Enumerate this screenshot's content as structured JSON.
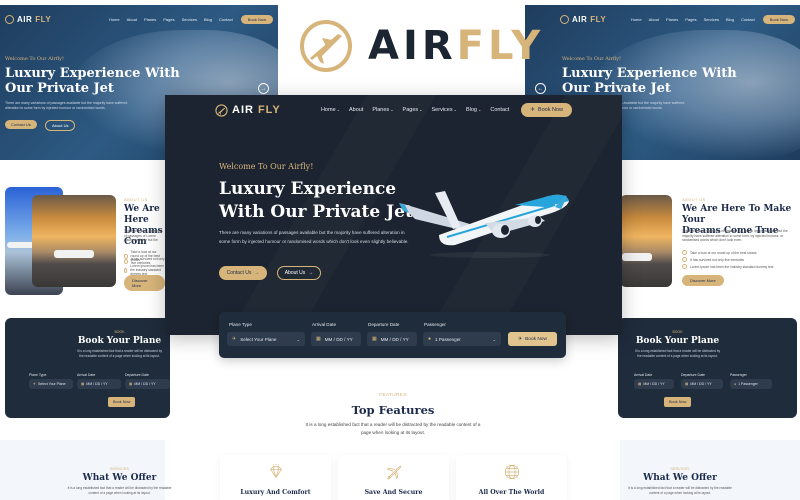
{
  "brand": {
    "name_part1": "AIR",
    "name_part2": "FLY",
    "accent_color": "#d7b47a",
    "dark_color": "#1b2430"
  },
  "nav": {
    "items": [
      {
        "label": "Home",
        "dropdown": true
      },
      {
        "label": "About",
        "dropdown": false
      },
      {
        "label": "Planes",
        "dropdown": true
      },
      {
        "label": "Pages",
        "dropdown": true
      },
      {
        "label": "Services",
        "dropdown": true
      },
      {
        "label": "Blog",
        "dropdown": true
      },
      {
        "label": "Contact",
        "dropdown": false
      }
    ],
    "book_now": "Book Now",
    "chevron": "⌄"
  },
  "hero": {
    "welcome": "Welcome To Our Airfly!",
    "title_line1": "Luxury Experience",
    "title_line2": "With Our Private Jet",
    "side_title_line1": "Luxury Experience With",
    "side_title_line2": "Our Private Jet",
    "paragraph": "There are many variations of passages available but the majority have suffered alteration in some form by injected humour or randomised words which don't look even slightly believable.",
    "side_paragraph": "There are many variations of passages available but the majority have suffered alteration in some form by injected humour or randomised words.",
    "contact_button": "Contact Us",
    "about_button": "About Us",
    "arrow": "→",
    "prev_arrow": "←"
  },
  "booking": {
    "fields": [
      {
        "label": "Plane Type",
        "value": "Select Your Plane",
        "icon": "plane-icon",
        "dropdown": true
      },
      {
        "label": "Arrival Date",
        "value": "MM / DD / YY",
        "icon": "calendar-icon",
        "dropdown": false
      },
      {
        "label": "Departure Date",
        "value": "MM / DD / YY",
        "icon": "calendar-icon",
        "dropdown": false
      },
      {
        "label": "Passenger",
        "value": "1 Passenger",
        "icon": "user-icon",
        "dropdown": true
      }
    ],
    "button": "Book Now"
  },
  "about": {
    "label": "ABOUT US",
    "title_line1": "We Are Here To Make Your",
    "title_line2": "Dreams Come True",
    "left_title_line1": "We Are Here",
    "left_title_line2": "Dreams Com",
    "paragraph": "There are many variations of passages of Lorem Ipsum available but the majority have suffered alteration in some form, by injected humour, or randomised words which don't look even.",
    "checks": [
      "Take a look at our round up of the best shows",
      "It has survived not only five centuries",
      "Lorem Ipsum has been the industry standard dummy text"
    ],
    "button": "Discover More"
  },
  "book_section": {
    "label": "BOOK",
    "title": "Book Your Plane",
    "paragraph_line1": "It is a long established fact that a reader will be distracted by",
    "paragraph_line2": "the readable content of a page when looking at its layout.",
    "button": "Book Now"
  },
  "features": {
    "label": "FEATURES",
    "title": "Top Features",
    "paragraph": "It is a long established fact that a reader will be distracted by the readable content of a page when looking at its layout.",
    "cards": [
      {
        "title": "Luxury And Comfort",
        "icon": "diamond-icon"
      },
      {
        "title": "Save And Secure",
        "icon": "airplane-icon"
      },
      {
        "title": "All Over The World",
        "icon": "globe-icon"
      }
    ]
  },
  "services": {
    "label": "SERVICES",
    "title": "What We Offer",
    "paragraph_line1": "It is a long established fact that a reader will be distracted by the readable",
    "paragraph_line2": "content of a page when looking at its layout."
  }
}
